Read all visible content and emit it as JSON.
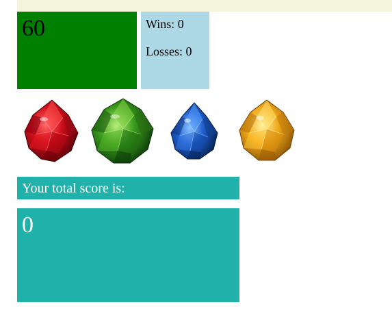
{
  "target": {
    "value": "60",
    "color": "#008000"
  },
  "stats": {
    "wins_label": "Wins: 0",
    "losses_label": "Losses: 0",
    "color": "#add8e6"
  },
  "gems": [
    {
      "name": "red-crystal-icon",
      "color": "#d0101a"
    },
    {
      "name": "green-crystal-icon",
      "color": "#3a9a1c"
    },
    {
      "name": "blue-crystal-icon",
      "color": "#1f5fd0"
    },
    {
      "name": "yellow-crystal-icon",
      "color": "#f0a818"
    }
  ],
  "score": {
    "label": "Your total score is:",
    "value": "0",
    "color": "#20b2aa"
  },
  "header_bar_color": "#f5f5dc"
}
